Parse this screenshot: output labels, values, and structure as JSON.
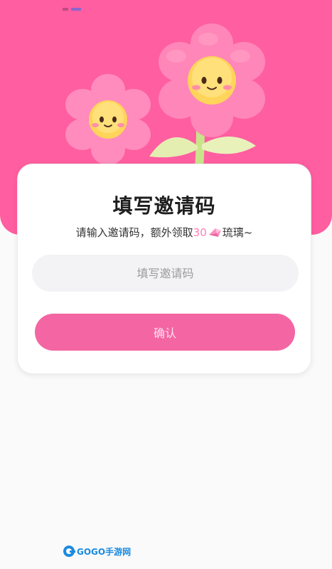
{
  "dialog": {
    "title": "填写邀请码",
    "subtitle_prefix": "请输入邀请码，额外领取",
    "reward_amount": "30",
    "reward_unit": "琉璃~",
    "reward_icon": "gem-icon"
  },
  "input": {
    "placeholder": "填写邀请码",
    "value": ""
  },
  "buttons": {
    "confirm_label": "确认"
  },
  "watermark": {
    "text": "GOGO手游网"
  },
  "colors": {
    "hero_background": "#ff5ea0",
    "button_background": "#f465a3",
    "reward_text": "#ff7fb4"
  }
}
